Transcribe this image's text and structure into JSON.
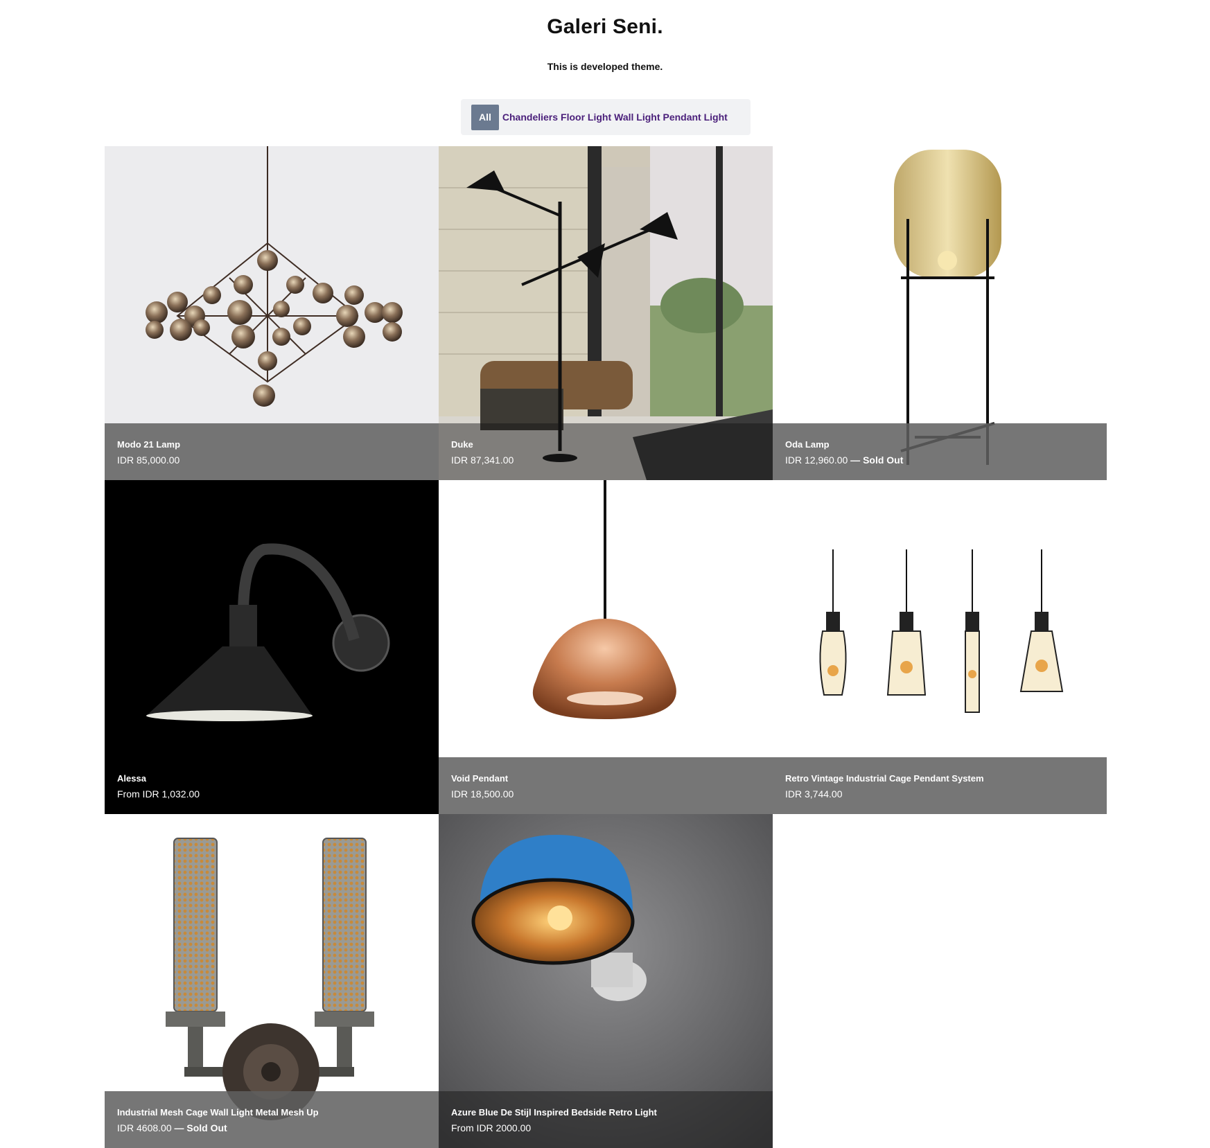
{
  "header": {
    "title": "Galeri Seni.",
    "tagline": "This is developed theme."
  },
  "filters": {
    "active": "All",
    "links": [
      "Chandeliers",
      "Floor Light",
      "Wall Light",
      "Pendant Light"
    ]
  },
  "products": [
    {
      "name": "Modo 21 Lamp",
      "price": "IDR 85,000.00",
      "sold_out": "",
      "icon": "chandelier-image"
    },
    {
      "name": "Duke",
      "price": "IDR 87,341.00",
      "sold_out": "",
      "icon": "floor-lamp-room-image"
    },
    {
      "name": "Oda Lamp",
      "price": "IDR 12,960.00",
      "sold_out": " — Sold Out",
      "icon": "glass-floor-lamp-image"
    },
    {
      "name": "Alessa",
      "price": "From IDR 1,032.00",
      "sold_out": "",
      "icon": "wall-sconce-image"
    },
    {
      "name": "Void Pendant",
      "price": "IDR 18,500.00",
      "sold_out": "",
      "icon": "copper-pendant-image"
    },
    {
      "name": "Retro Vintage Industrial Cage Pendant System",
      "price": "IDR 3,744.00",
      "sold_out": "",
      "icon": "cage-pendants-image"
    },
    {
      "name": "Industrial Mesh Cage Wall Light Metal Mesh Up",
      "price": "IDR 4608.00",
      "sold_out": " — Sold Out",
      "icon": "mesh-wall-light-image"
    },
    {
      "name": "Azure Blue De Stijl Inspired Bedside Retro Light",
      "price": "From IDR 2000.00",
      "sold_out": "",
      "icon": "blue-wall-lamp-image"
    }
  ],
  "colors": {
    "caption_overlay": "#5f5f5f",
    "filter_active_bg": "#6b7a90",
    "filter_link": "#4a1f7a"
  }
}
